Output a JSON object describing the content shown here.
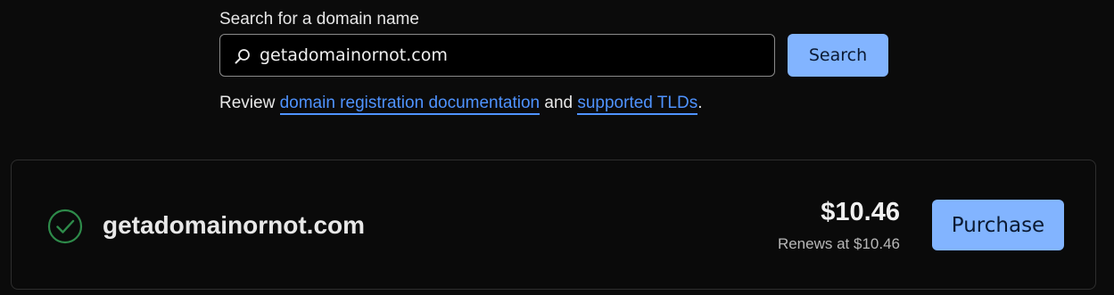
{
  "search": {
    "label": "Search for a domain name",
    "value": "getadomainornot.com",
    "button_label": "Search"
  },
  "review": {
    "prefix": "Review ",
    "link1": "domain registration documentation",
    "middle": " and ",
    "link2": "supported TLDs",
    "suffix": "."
  },
  "result": {
    "domain": "getadomainornot.com",
    "price": "$10.46",
    "renews": "Renews at $10.46",
    "purchase_label": "Purchase",
    "status_icon": "check-circle-icon"
  },
  "colors": {
    "background": "#0b0b0b",
    "accent_button": "#82b4ff",
    "link": "#4f93ff",
    "success": "#2e8b4a"
  }
}
